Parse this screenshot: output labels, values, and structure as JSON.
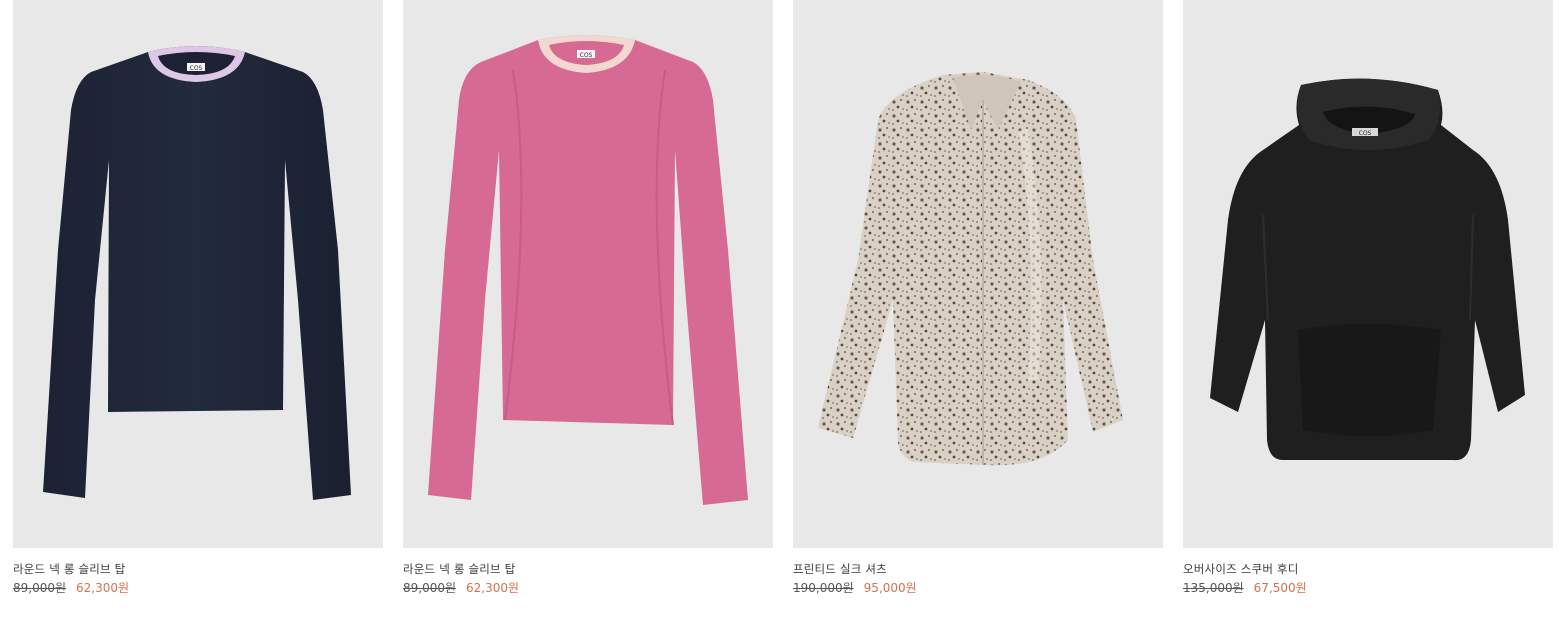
{
  "colors": {
    "image_background": "#e8e8e8",
    "sale_price": "#d2724f",
    "text": "#3a3a3a"
  },
  "products": [
    {
      "name": "라운드 넥 롱 슬리브 탑",
      "original_price": "89,000원",
      "sale_price": "62,300원",
      "image_icon": "navy-long-sleeve-top-image",
      "label": "COS"
    },
    {
      "name": "라운드 넥 롱 슬리브 탑",
      "original_price": "89,000원",
      "sale_price": "62,300원",
      "image_icon": "pink-long-sleeve-top-image",
      "label": "COS"
    },
    {
      "name": "프린티드 실크 셔츠",
      "original_price": "190,000원",
      "sale_price": "95,000원",
      "image_icon": "printed-silk-shirt-image",
      "label": ""
    },
    {
      "name": "오버사이즈 스쿠버 후디",
      "original_price": "135,000원",
      "sale_price": "67,500원",
      "image_icon": "oversized-scuba-hoodie-image",
      "label": "COS"
    }
  ]
}
